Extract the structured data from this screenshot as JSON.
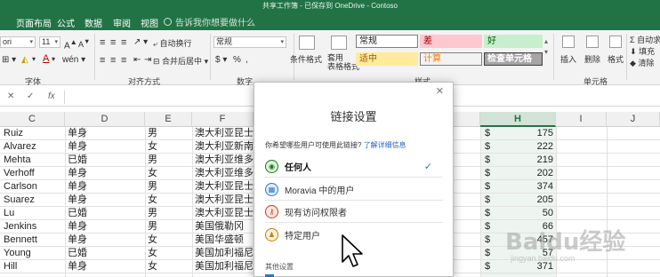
{
  "app": {
    "title": "共享工作簿 - 已保存到 OneDrive - Contoso",
    "accent": "#217346"
  },
  "tabs": [
    {
      "label": "页面布局"
    },
    {
      "label": "公式"
    },
    {
      "label": "数据"
    },
    {
      "label": "审阅"
    },
    {
      "label": "视图"
    }
  ],
  "tell_me": {
    "placeholder": "告诉我你想要做什么"
  },
  "ribbon": {
    "font_name": "ori",
    "font_size": "11",
    "wrap_text": "自动换行",
    "merge_center": "合并后居中",
    "number_format": "常规",
    "conditional_format": "条件格式",
    "format_as_table": "套用\n表格格式",
    "styles": [
      {
        "label": "常规",
        "bg": "#ffffff",
        "fg": "#222222",
        "border": "#7f7f7f"
      },
      {
        "label": "差",
        "bg": "#ffc7ce",
        "fg": "#9c0006",
        "border": "#ffc7ce"
      },
      {
        "label": "好",
        "bg": "#c6efce",
        "fg": "#006100",
        "border": "#c6efce"
      },
      {
        "label": "适中",
        "bg": "#ffeb9c",
        "fg": "#9c5700",
        "border": "#ffeb9c"
      },
      {
        "label": "计算",
        "bg": "#f2f2f2",
        "fg": "#fa7d00",
        "border": "#7f7f7f"
      },
      {
        "label": "检查单元格",
        "bg": "#a5a5a5",
        "fg": "#ffffff",
        "border": "#3f3f3f"
      }
    ],
    "insert": "插入",
    "delete": "删除",
    "format": "格式",
    "autosum": "自动求",
    "fill": "填充",
    "clear": "清除",
    "groups": {
      "font": "字体",
      "alignment": "对齐方式",
      "number": "数字",
      "styles": "样式",
      "cells": "单元格"
    }
  },
  "formula_bar": {
    "cancel": "✕",
    "enter": "✓",
    "fx": "fx"
  },
  "columns": [
    "C",
    "D",
    "E",
    "F",
    "G",
    "H",
    "I",
    "J"
  ],
  "rows": [
    {
      "name": "Ruiz",
      "status": "单身",
      "gender": "男",
      "country": "澳大利亚昆士",
      "currency": "$",
      "amount": "175"
    },
    {
      "name": "Alvarez",
      "status": "单身",
      "gender": "女",
      "country": "澳大利亚新南",
      "currency": "$",
      "amount": "222"
    },
    {
      "name": "Mehta",
      "status": "已婚",
      "gender": "男",
      "country": "澳大利亚维多",
      "currency": "$",
      "amount": "219"
    },
    {
      "name": "Verhoff",
      "status": "单身",
      "gender": "女",
      "country": "澳大利亚维多",
      "currency": "$",
      "amount": "202"
    },
    {
      "name": "Carlson",
      "status": "单身",
      "gender": "男",
      "country": "澳大利亚昆士",
      "currency": "$",
      "amount": "374"
    },
    {
      "name": "Suarez",
      "status": "单身",
      "gender": "女",
      "country": "澳大利亚昆士",
      "currency": "$",
      "amount": "205"
    },
    {
      "name": "Lu",
      "status": "已婚",
      "gender": "男",
      "country": "澳大利亚昆士",
      "currency": "$",
      "amount": "50"
    },
    {
      "name": "Jenkins",
      "status": "单身",
      "gender": "男",
      "country": "美国俄勒冈",
      "currency": "$",
      "amount": "66"
    },
    {
      "name": "Bennett",
      "status": "单身",
      "gender": "女",
      "country": "美国华盛顿",
      "currency": "$",
      "amount": "457"
    },
    {
      "name": "Young",
      "status": "已婚",
      "gender": "女",
      "country": "美国加利福尼",
      "currency": "$",
      "amount": "57"
    },
    {
      "name": "Hill",
      "status": "单身",
      "gender": "女",
      "country": "美国加利福尼",
      "currency": "$",
      "amount": "371"
    }
  ],
  "dialog": {
    "title": "链接设置",
    "question": "你希望哪些用户可使用此链接?",
    "learn_more": "了解详细信息",
    "options": [
      {
        "label": "任何人",
        "icon": "globe-icon",
        "selected": true
      },
      {
        "label": "Moravia 中的用户",
        "icon": "building-icon",
        "selected": false
      },
      {
        "label": "现有访问权限者",
        "icon": "key-icon",
        "selected": false
      },
      {
        "label": "特定用户",
        "icon": "person-icon",
        "selected": false
      }
    ],
    "other_settings": "其他设置"
  },
  "watermark": {
    "text": "Baidu经验",
    "sub": "jingyan.baidu.com"
  }
}
